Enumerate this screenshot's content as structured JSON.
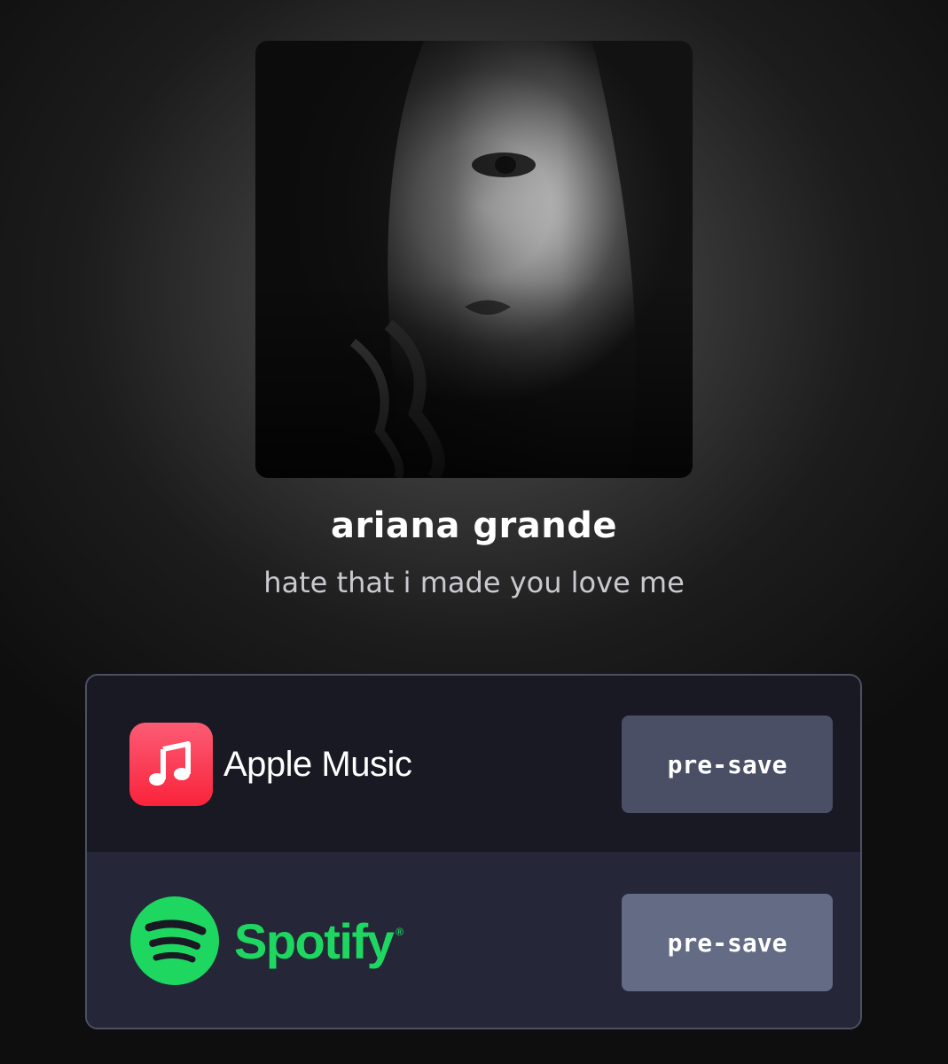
{
  "release": {
    "artist": "ariana grande",
    "title": "hate that i made you love me",
    "cover_description": "black and white portrait album cover"
  },
  "services": [
    {
      "name": "Apple Music",
      "icon": "apple-music-icon",
      "brand_color": "#fa243c",
      "action_label": "pre-save"
    },
    {
      "name": "Spotify",
      "icon": "spotify-icon",
      "brand_color": "#1ed760",
      "action_label": "pre-save"
    }
  ],
  "colors": {
    "panel_border": "#4b5063",
    "apple_row_bg": "#191923",
    "spotify_row_bg": "#252738",
    "apple_button_bg": "#4a4f65",
    "spotify_button_bg": "#646b85"
  }
}
